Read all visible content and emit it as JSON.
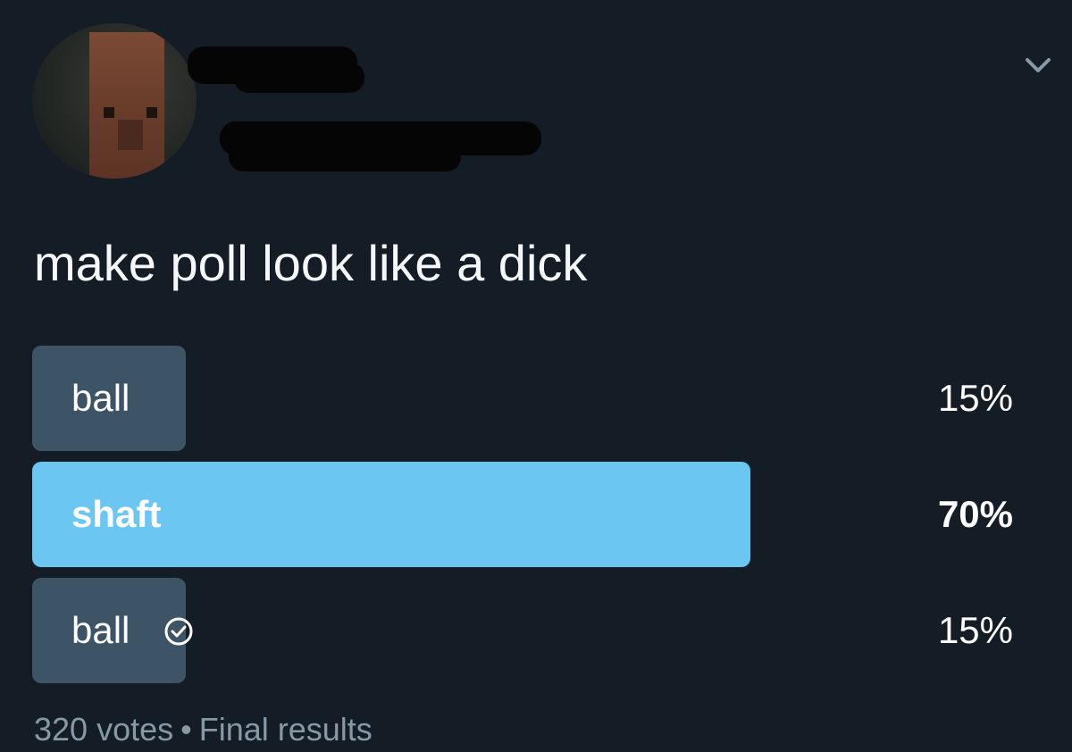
{
  "tweet": {
    "text": "make poll look like a dick"
  },
  "poll": {
    "options": [
      {
        "label": "ball",
        "percent_label": "15%",
        "percent": 15,
        "winner": false,
        "selected": false
      },
      {
        "label": "shaft",
        "percent_label": "70%",
        "percent": 70,
        "winner": true,
        "selected": false
      },
      {
        "label": "ball",
        "percent_label": "15%",
        "percent": 15,
        "winner": false,
        "selected": true
      }
    ],
    "votes_label": "320 votes",
    "separator": "•",
    "status_label": "Final results"
  },
  "icons": {
    "menu": "chevron-down-icon",
    "selected": "check-circle-icon"
  },
  "colors": {
    "background": "#141d26",
    "bar": "#3d5466",
    "winner_bar": "#6cc6f2",
    "meta_text": "#8899a6"
  }
}
